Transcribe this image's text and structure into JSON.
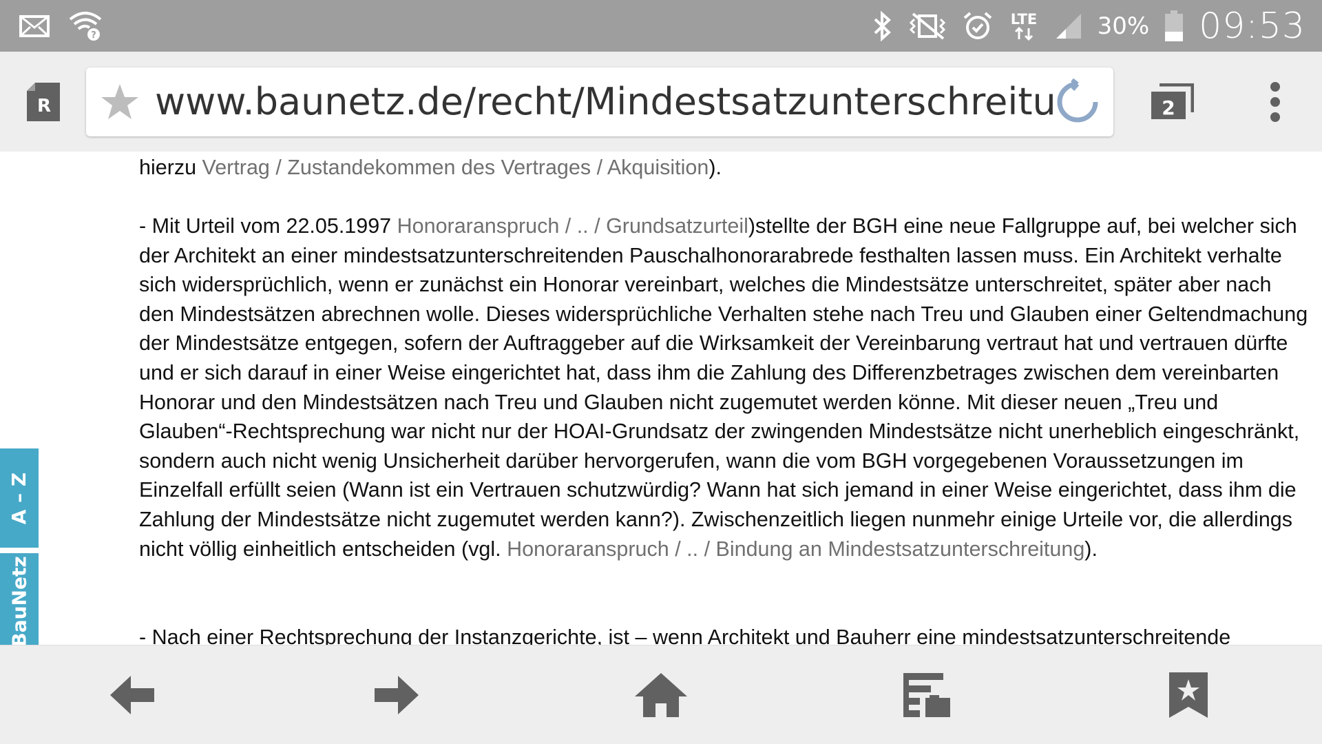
{
  "status_bar": {
    "battery_percent": "30%",
    "time": "09:53",
    "network": "LTE",
    "icons": [
      "mail-icon",
      "wifi-icon",
      "bluetooth-icon",
      "vibrate-icon",
      "alarm-icon",
      "lte-icon",
      "signal-icon",
      "battery-icon"
    ]
  },
  "toolbar": {
    "reader_label": "R",
    "url": "www.baunetz.de/recht/Mindestsatzunterschreitungen",
    "tab_count": "2"
  },
  "article": {
    "p1": {
      "prefix": "hierzu ",
      "link": "Vertrag / Zustandekommen des Vertrages / Akquisition",
      "suffix": ")."
    },
    "p2": {
      "prefix": "- Mit Urteil vom 22.05.1997 ",
      "link1": "Honoraranspruch / .. / Grundsatzurteil",
      "body": ")stellte der BGH eine neue Fallgruppe auf, bei welcher sich der Architekt an einer mindestsatzunterschreitenden Pauschalhonorarabrede festhalten lassen muss. Ein Architekt verhalte sich widersprüchlich, wenn er zunächst ein Honorar vereinbart, welches die Mindestsätze unterschreitet, später aber nach den Mindestsätzen abrechnen wolle. Dieses widersprüchliche Verhalten stehe nach Treu und Glauben einer Geltendmachung der Mindestsätze entgegen, sofern der Auftraggeber auf die Wirksamkeit der Vereinbarung vertraut hat und vertrauen dürfte und er sich darauf in einer Weise eingerichtet hat, dass ihm die Zahlung des Differenzbetrages zwischen dem vereinbarten Honorar und den Mindestsätzen nach Treu und Glauben nicht zugemutet werden könne. Mit dieser neuen „Treu und Glauben“-Rechtsprechung war nicht nur der HOAI-Grundsatz der zwingenden Mindestsätze nicht unerheblich eingeschränkt, sondern auch nicht wenig Unsicherheit darüber hervorgerufen, wann die vom BGH vorgegebenen Voraussetzungen im Einzelfall erfüllt seien (Wann ist ein Vertrauen schutzwürdig? Wann hat sich jemand in einer Weise eingerichtet, dass ihm die Zahlung der Mindestsätze nicht zugemutet werden kann?). Zwischenzeitlich liegen nunmehr einige Urteile vor, die allerdings nicht völlig einheitlich entscheiden (vgl. ",
      "link2": "Honoraranspruch / .. / Bindung an Mindestsatzunterschreitung",
      "suffix": ")."
    },
    "p3": {
      "text": "- Nach einer Rechtsprechung der Instanzgerichte, ist – wenn Architekt und Bauherr eine mindestsatzunterschreitende"
    }
  },
  "side_tabs": {
    "az": "A – Z",
    "baunetz": "BauNetz"
  },
  "colors": {
    "status_bar": "#9e9e9e",
    "toolbar": "#eeeeee",
    "link": "#707070",
    "side_tab": "#47a9c8",
    "icon_grey": "#707070",
    "reload_blue": "#8fa8c8"
  }
}
